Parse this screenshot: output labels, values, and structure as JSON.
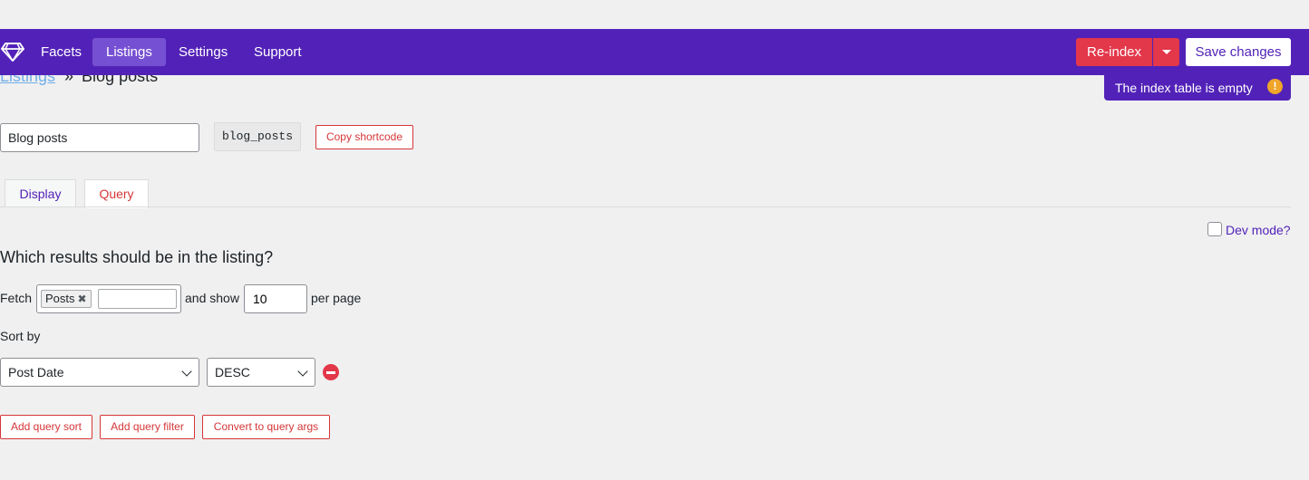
{
  "nav": {
    "items": [
      {
        "label": "Facets"
      },
      {
        "label": "Listings"
      },
      {
        "label": "Settings"
      },
      {
        "label": "Support"
      }
    ],
    "active": "Listings",
    "reindex_label": "Re-index",
    "save_label": "Save changes"
  },
  "toast": {
    "text": "The index table is empty",
    "icon": "!"
  },
  "breadcrumb": {
    "parent": "Listings",
    "separator": "»",
    "current": "Blog posts"
  },
  "listing": {
    "name_value": "Blog posts",
    "slug": "blog_posts",
    "copy_shortcode_label": "Copy shortcode"
  },
  "tabs": [
    {
      "label": "Display"
    },
    {
      "label": "Query"
    }
  ],
  "active_tab": "Query",
  "dev_mode": {
    "label": "Dev mode?",
    "checked": false
  },
  "query": {
    "title": "Which results should be in the listing?",
    "fetch_label": "Fetch",
    "fetch_tokens": [
      {
        "label": "Posts"
      }
    ],
    "and_show_label": "and show",
    "per_page_value": "10",
    "per_page_label": "per page",
    "sort_by_label": "Sort by",
    "sort_field": "Post Date",
    "sort_order": "DESC",
    "buttons": {
      "add_sort": "Add query sort",
      "add_filter": "Add query filter",
      "convert": "Convert to query args"
    }
  },
  "colors": {
    "brand": "#5222b8",
    "danger": "#e3374a",
    "link": "#72aee6",
    "warning": "#f0a429"
  }
}
